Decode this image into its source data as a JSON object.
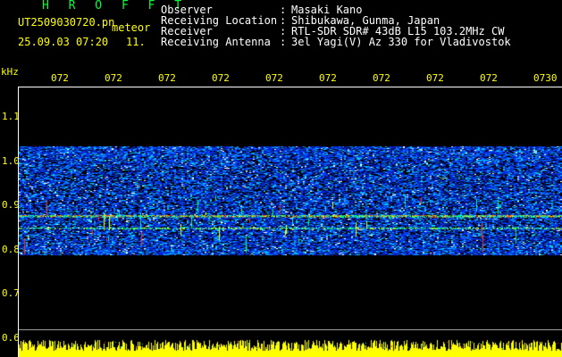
{
  "header": {
    "brand": "H R O F F T",
    "file_name": "UT2509030720.pn",
    "file_suffix": "meteor",
    "date_time": "25.09.03 07:20",
    "count": "11."
  },
  "metadata": {
    "rows": [
      {
        "key": "Observer",
        "value": "Masaki Kano"
      },
      {
        "key": "Receiving Location",
        "value": "Shibukawa, Gunma, Japan"
      },
      {
        "key": "Receiver",
        "value": "RTL-SDR SDR# 43dB L15 103.2MHz CW"
      },
      {
        "key": "Receiving Antenna",
        "value": "3el Yagi(V) Az 330 for Vladivostok"
      }
    ],
    "separator": ":"
  },
  "axis": {
    "y_unit": "kHz",
    "y_labels": [
      "1.1",
      "1.0",
      "0.9",
      "0.8",
      "0.7",
      "0.6"
    ],
    "x_labels": [
      "072",
      "072",
      "072",
      "072",
      "072",
      "072",
      "072",
      "072",
      "072",
      "0730"
    ]
  },
  "colors": {
    "brand": "#00ff3c",
    "timestamp": "#ffff00",
    "axis": "#ffffff",
    "background": "#000000"
  }
}
